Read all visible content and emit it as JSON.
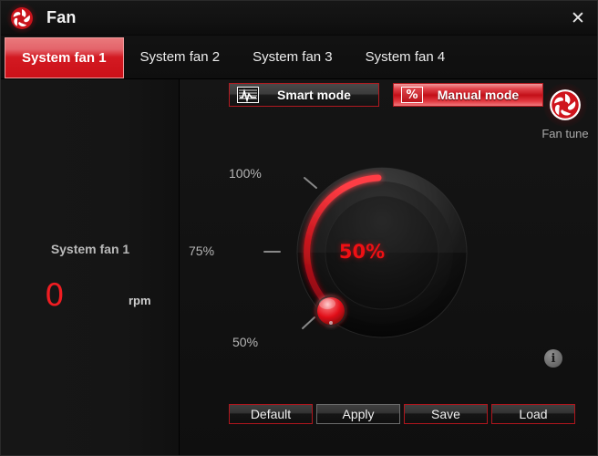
{
  "window": {
    "title": "Fan",
    "logo_icon": "fan-pinwheel-icon",
    "close_icon": "✕"
  },
  "tabs": [
    {
      "label": "System fan 1",
      "active": true
    },
    {
      "label": "System fan 2",
      "active": false
    },
    {
      "label": "System fan 3",
      "active": false
    },
    {
      "label": "System fan 4",
      "active": false
    }
  ],
  "left_panel": {
    "fan_label": "System fan 1",
    "rpm_value": "0",
    "rpm_unit": "rpm"
  },
  "modes": {
    "smart": {
      "label": "Smart mode",
      "icon": "waveform-chart-icon",
      "active": false
    },
    "manual": {
      "label": "Manual mode",
      "icon": "percent-icon",
      "active": true
    }
  },
  "dial": {
    "center_value": "50%",
    "ticks": [
      {
        "label": "100%",
        "position": "upper-left"
      },
      {
        "label": "75%",
        "position": "left"
      },
      {
        "label": "50%",
        "position": "lower-left"
      }
    ],
    "handle_icon": "dial-handle-knob"
  },
  "fan_tune": {
    "label": "Fan tune",
    "icon": "fan-pinwheel-icon"
  },
  "info": {
    "icon": "info-icon",
    "glyph": "i"
  },
  "footer_buttons": [
    {
      "label": "Default",
      "style": "red"
    },
    {
      "label": "Apply",
      "style": "grey"
    },
    {
      "label": "Save",
      "style": "red"
    },
    {
      "label": "Load",
      "style": "red"
    }
  ],
  "colors": {
    "accent_red": "#cc1018",
    "bright_red": "#ef1d22",
    "panel_bg": "#131313",
    "titlebar_bg": "#121212",
    "text_primary": "#f2f2f2",
    "text_muted": "#b6b6b6"
  }
}
